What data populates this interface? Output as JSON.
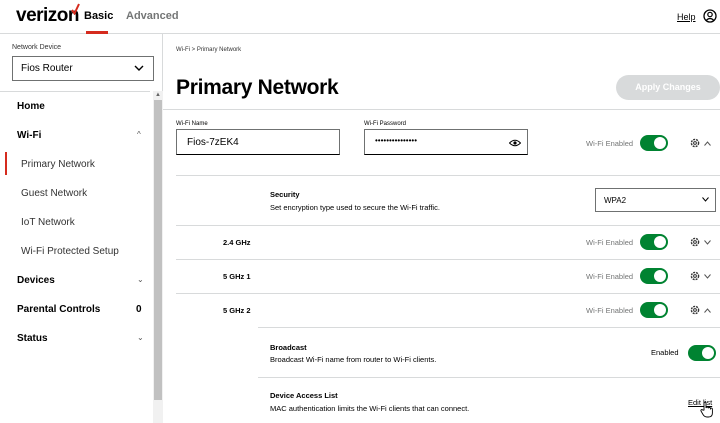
{
  "header": {
    "logo_text": "verizon",
    "tabs": [
      {
        "label": "Basic"
      },
      {
        "label": "Advanced"
      }
    ],
    "help_label": "Help",
    "icons": {
      "logo_check": "check-icon",
      "user": "user-icon"
    },
    "colors": {
      "brand_red": "#d52b1e",
      "toggle_green": "#008331"
    }
  },
  "sidebar": {
    "device_label": "Network Device",
    "device_value": "Fios Router",
    "items": [
      {
        "label": "Home"
      },
      {
        "label": "Wi-Fi"
      },
      {
        "label": "Primary Network"
      },
      {
        "label": "Guest Network"
      },
      {
        "label": "IoT Network"
      },
      {
        "label": "Wi-Fi Protected Setup"
      },
      {
        "label": "Devices"
      },
      {
        "label": "Parental Controls",
        "count": "0"
      },
      {
        "label": "Status"
      }
    ]
  },
  "main": {
    "breadcrumb": "Wi-Fi  >  Primary Network",
    "title": "Primary Network",
    "apply_label": "Apply Changes",
    "wifi_name_label": "Wi-Fi Name",
    "wifi_name_value": "Fios-7zEK4",
    "wifi_password_label": "Wi-Fi Password",
    "wifi_password_value": "•••••••••••••••",
    "wifi_enabled_label": "Wi-Fi Enabled",
    "security": {
      "title": "Security",
      "desc": "Set encryption type used to secure the Wi-Fi traffic.",
      "value": "WPA2"
    },
    "bands": [
      {
        "label": "2.4 GHz",
        "status": "Wi-Fi Enabled"
      },
      {
        "label": "5 GHz 1",
        "status": "Wi-Fi Enabled"
      },
      {
        "label": "5 GHz 2",
        "status": "Wi-Fi Enabled"
      }
    ],
    "broadcast": {
      "title": "Broadcast",
      "desc": "Broadcast Wi-Fi name from router to Wi-Fi clients.",
      "status": "Enabled"
    },
    "access_list": {
      "title": "Device Access List",
      "desc": "MAC authentication limits the Wi-Fi clients that can connect.",
      "link": "Edit list"
    }
  }
}
